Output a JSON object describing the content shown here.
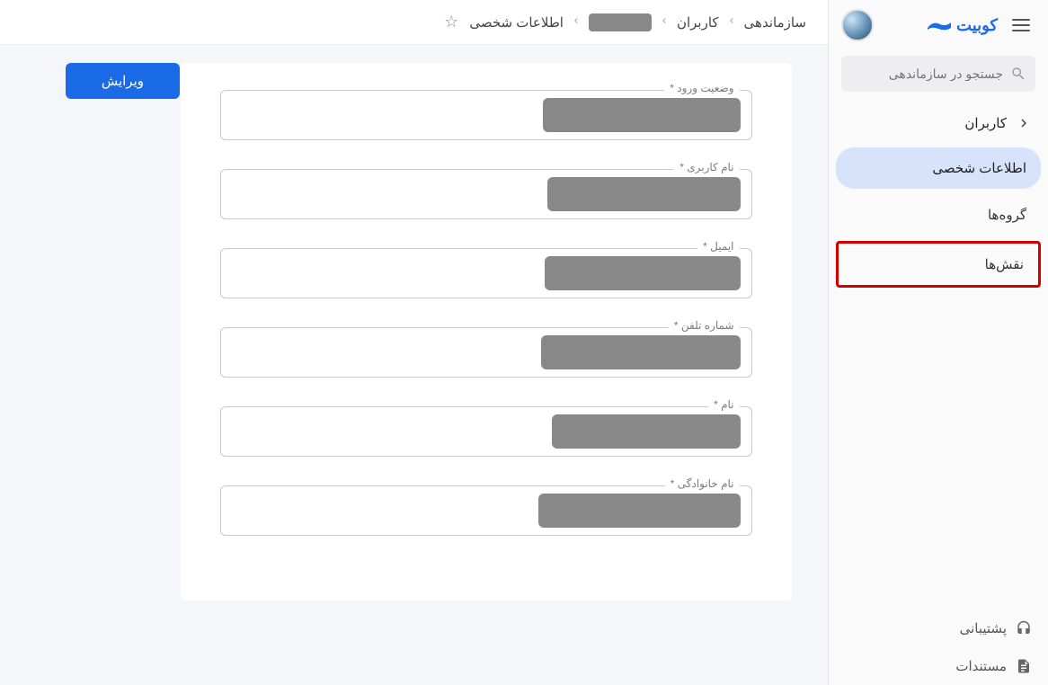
{
  "brand": {
    "name": "کوبیت"
  },
  "search": {
    "placeholder": "جستجو در سازماندهی"
  },
  "sidebar": {
    "back": "کاربران",
    "items": [
      {
        "label": "اطلاعات شخصی"
      },
      {
        "label": "گروه‌ها"
      },
      {
        "label": "نقش‌ها"
      }
    ],
    "footer": [
      {
        "label": "پشتیبانی"
      },
      {
        "label": "مستندات"
      }
    ]
  },
  "breadcrumb": {
    "a": "سازماندهی",
    "b": "کاربران",
    "d": "اطلاعات شخصی"
  },
  "actions": {
    "edit": "ویرایش"
  },
  "form": {
    "fields": [
      {
        "label": "وضعیت ورود *"
      },
      {
        "label": "نام کاربری *"
      },
      {
        "label": "ایمیل *"
      },
      {
        "label": "شماره تلفن *"
      },
      {
        "label": "نام *"
      },
      {
        "label": "نام خانوادگی *"
      }
    ]
  }
}
